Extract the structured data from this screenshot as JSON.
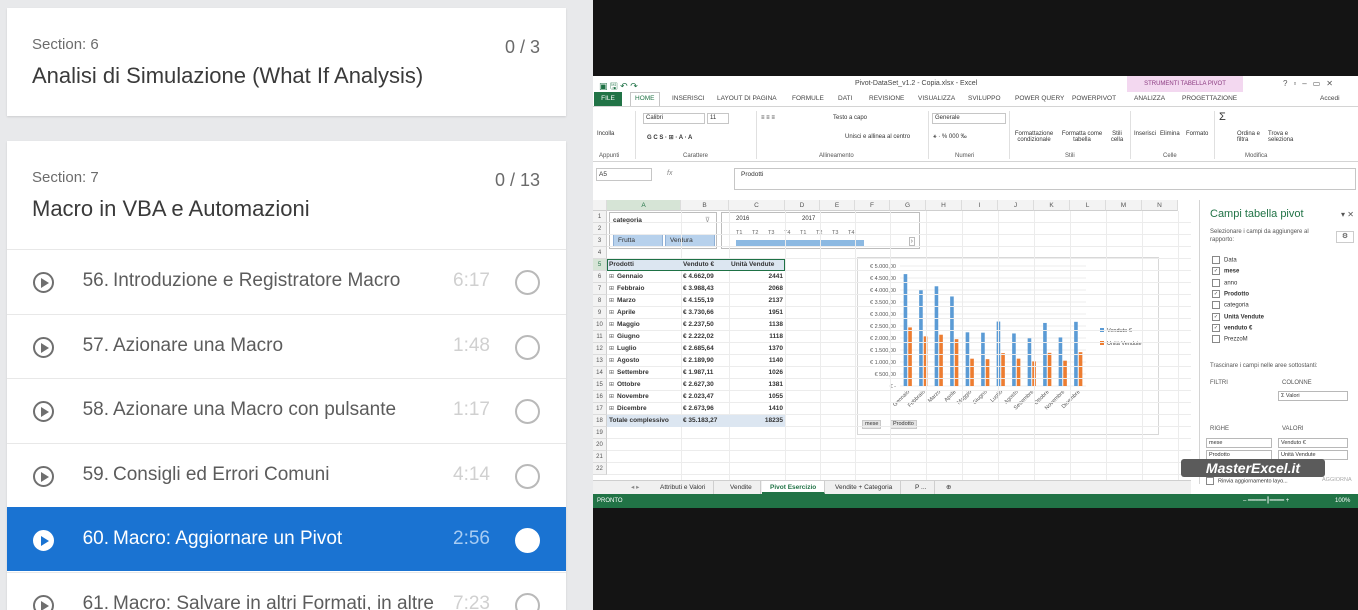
{
  "course": {
    "sections": [
      {
        "label": "Section: 6",
        "title": "Analisi di Simulazione (What If Analysis)",
        "progress": "0 / 3"
      },
      {
        "label": "Section: 7",
        "title": "Macro in VBA e Automazioni",
        "progress": "0 / 13"
      }
    ],
    "lectures": [
      {
        "num": "56.",
        "title": "Introduzione e Registratore Macro",
        "duration": "6:17"
      },
      {
        "num": "57.",
        "title": "Azionare una Macro",
        "duration": "1:48"
      },
      {
        "num": "58.",
        "title": "Azionare una Macro con pulsante",
        "duration": "1:17"
      },
      {
        "num": "59.",
        "title": "Consigli ed Errori Comuni",
        "duration": "4:14"
      },
      {
        "num": "60.",
        "title": "Macro: Aggiornare un Pivot",
        "duration": "2:56"
      },
      {
        "num": "61.",
        "title": "Macro: Salvare in altri Formati, in altre",
        "duration": "7:23"
      }
    ],
    "active_lecture": "60."
  },
  "excel": {
    "window_title": "Pivot-DataSet_v1.2 - Copia.xlsx - Excel",
    "pivot_tools_label": "STRUMENTI TABELLA PIVOT",
    "account": "Accedi",
    "tabs": [
      "FILE",
      "HOME",
      "INSERISCI",
      "LAYOUT DI PAGINA",
      "FORMULE",
      "DATI",
      "REVISIONE",
      "VISUALIZZA",
      "SVILUPPO",
      "POWER QUERY",
      "POWERPIVOT",
      "ANALIZZA",
      "PROGETTAZIONE"
    ],
    "ribbon": {
      "paste": "Incolla",
      "font_name": "Calibri",
      "font_size": "11",
      "wrap_text": "Testo a capo",
      "merge": "Unisci e allinea al centro",
      "number_format": "Generale",
      "cond_format": "Formattazione condizionale",
      "format_table": "Formatta come tabella",
      "cell_styles": "Stili cella",
      "insert": "Inserisci",
      "delete": "Elimina",
      "format": "Formato",
      "sort": "Ordina e filtra",
      "find": "Trova e seleziona",
      "groups": [
        "Appunti",
        "Carattere",
        "Allineamento",
        "Numeri",
        "Stili",
        "Celle",
        "Modifica"
      ]
    },
    "name_box": "A5",
    "fx": "fx",
    "formula": "Prodotti",
    "columns": [
      "A",
      "B",
      "C",
      "D",
      "E",
      "F",
      "G",
      "H",
      "I",
      "J",
      "K",
      "L",
      "M",
      "N"
    ],
    "slicer": {
      "title": "categoria",
      "items": [
        "Frutta",
        "Verdura"
      ]
    },
    "timeline": {
      "years": [
        "2016",
        "2017"
      ],
      "quarters": [
        "T1",
        "T2",
        "T3",
        "T4",
        "T1",
        "T2",
        "T3",
        "T4"
      ]
    },
    "pivot": {
      "headers": [
        "Prodotti",
        "Venduto €",
        "Unità Vendute"
      ],
      "rows": [
        {
          "name": "Gennaio",
          "venduto": "€   4.662,09",
          "unita": "2441"
        },
        {
          "name": "Febbraio",
          "venduto": "€   3.988,43",
          "unita": "2068"
        },
        {
          "name": "Marzo",
          "venduto": "€   4.155,19",
          "unita": "2137"
        },
        {
          "name": "Aprile",
          "venduto": "€   3.730,66",
          "unita": "1951"
        },
        {
          "name": "Maggio",
          "venduto": "€   2.237,50",
          "unita": "1138"
        },
        {
          "name": "Giugno",
          "venduto": "€   2.222,02",
          "unita": "1118"
        },
        {
          "name": "Luglio",
          "venduto": "€   2.685,64",
          "unita": "1370"
        },
        {
          "name": "Agosto",
          "venduto": "€   2.189,90",
          "unita": "1140"
        },
        {
          "name": "Settembre",
          "venduto": "€   1.987,11",
          "unita": "1026"
        },
        {
          "name": "Ottobre",
          "venduto": "€   2.627,30",
          "unita": "1381"
        },
        {
          "name": "Novembre",
          "venduto": "€   2.023,47",
          "unita": "1055"
        },
        {
          "name": "Dicembre",
          "venduto": "€   2.673,96",
          "unita": "1410"
        }
      ],
      "total": {
        "name": "Totale complessivo",
        "venduto": "€ 35.183,27",
        "unita": "18235"
      }
    },
    "chart_data": {
      "type": "bar",
      "categories": [
        "Gennaio",
        "Febbraio",
        "Marzo",
        "Aprile",
        "Maggio",
        "Giugno",
        "Luglio",
        "Agosto",
        "Settembre",
        "Ottobre",
        "Novembre",
        "Dicembre"
      ],
      "series": [
        {
          "name": "Venduto €",
          "color": "#5b9bd5",
          "values": [
            4662.09,
            3988.43,
            4155.19,
            3730.66,
            2237.5,
            2222.02,
            2685.64,
            2189.9,
            1987.11,
            2627.3,
            2023.47,
            2673.96
          ]
        },
        {
          "name": "Unità Vendute",
          "color": "#ed7d31",
          "values": [
            2441,
            2068,
            2137,
            1951,
            1138,
            1118,
            1370,
            1140,
            1026,
            1381,
            1055,
            1410
          ]
        }
      ],
      "yticks": [
        "€ 5.000,00",
        "€ 4.500,00",
        "€ 4.000,00",
        "€ 3.500,00",
        "€ 3.000,00",
        "€ 2.500,00",
        "€ 2.000,00",
        "€ 1.500,00",
        "€ 1.000,00",
        "€ 500,00",
        "€ -"
      ],
      "ylim": [
        0,
        5000
      ],
      "legend_position": "right",
      "filter_buttons": [
        "mese",
        "Prodotto"
      ]
    },
    "field_pane": {
      "title": "Campi tabella pivot",
      "subtitle": "Selezionare i campi da aggiungere al rapporto:",
      "fields": [
        {
          "label": "Data",
          "checked": false
        },
        {
          "label": "mese",
          "checked": true
        },
        {
          "label": "anno",
          "checked": false
        },
        {
          "label": "Prodotto",
          "checked": true
        },
        {
          "label": "categoria",
          "checked": false
        },
        {
          "label": "Unità Vendute",
          "checked": true
        },
        {
          "label": "venduto €",
          "checked": true
        },
        {
          "label": "PrezzoM",
          "checked": false
        }
      ],
      "drag_hint": "Trascinare i campi nelle aree sottostanti:",
      "filters": "FILTRI",
      "columns": "COLONNE",
      "columns_item": "Σ Valori",
      "rows": "RIGHE",
      "rows_items": [
        "mese",
        "Prodotto"
      ],
      "values": "VALORI",
      "values_items": [
        "Venduto €",
        "Unità Vendute"
      ],
      "defer": "Rinvia aggiornamento layo...",
      "update": "AGGIORNA"
    },
    "sheet_tabs": [
      "Attributi e Valori",
      "Vendite",
      "Pivot Esercizio",
      "Vendite + Categoria",
      "P ..."
    ],
    "active_sheet": "Pivot Esercizio",
    "status": {
      "ready": "PRONTO",
      "zoom": "100%"
    },
    "watermark": "MasterExcel.it"
  }
}
